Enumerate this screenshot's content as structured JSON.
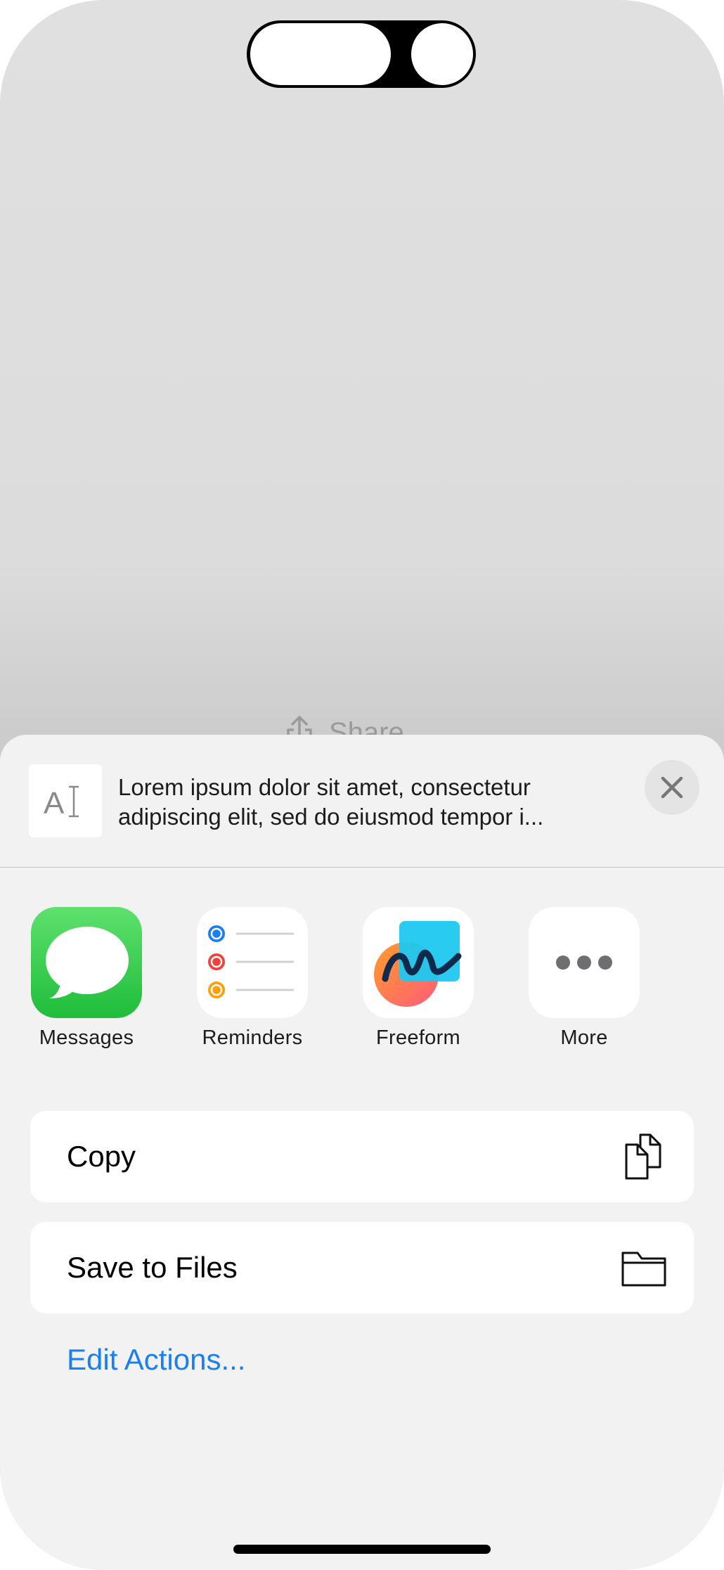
{
  "background": {
    "share_label": "Share",
    "share_icon": "share-icon"
  },
  "preview": {
    "thumb_icon": "text-document-icon",
    "line1": "Lorem ipsum dolor sit amet, consectetur",
    "line2": "adipiscing elit, sed do eiusmod tempor i...",
    "close_icon": "close-icon"
  },
  "apps": [
    {
      "label": "Messages",
      "icon": "messages-icon"
    },
    {
      "label": "Reminders",
      "icon": "reminders-icon"
    },
    {
      "label": "Freeform",
      "icon": "freeform-icon"
    },
    {
      "label": "More",
      "icon": "more-icon"
    }
  ],
  "actions": [
    {
      "label": "Copy",
      "icon": "copy-icon"
    },
    {
      "label": "Save to Files",
      "icon": "folder-icon"
    }
  ],
  "edit_actions_label": "Edit Actions...",
  "colors": {
    "link": "#1a7ff0",
    "messages_green": "#2fc84a",
    "sheet_bg": "#f2f2f2"
  }
}
